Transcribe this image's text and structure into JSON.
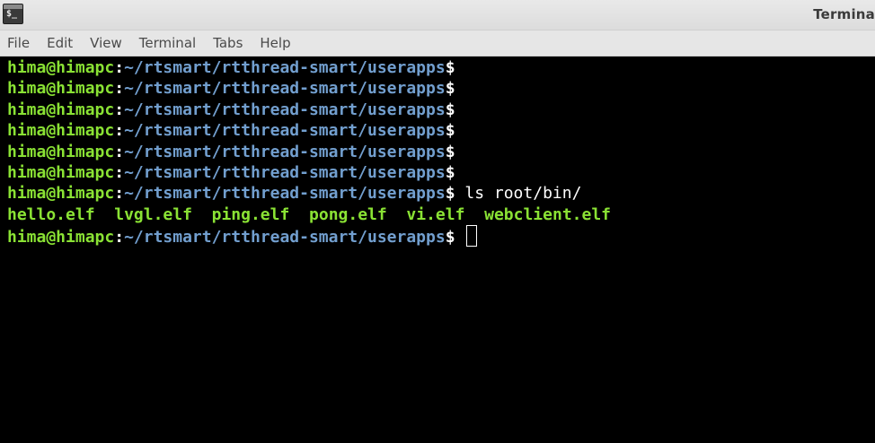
{
  "window": {
    "title": "Termina",
    "icon": "terminal-app-icon",
    "icon_glyph": "$_"
  },
  "menu": {
    "items": [
      "File",
      "Edit",
      "View",
      "Terminal",
      "Tabs",
      "Help"
    ]
  },
  "colors": {
    "background": "#000000",
    "userhost": "#8ae234",
    "path": "#729fcf",
    "text": "#ffffff",
    "executable": "#8ae234"
  },
  "terminal": {
    "prompt": {
      "userhost": "hima@himapc",
      "separator": ":",
      "path": "~/rtsmart/rtthread-smart/userapps",
      "sign": "$"
    },
    "command": "ls root/bin/",
    "ls_output": [
      "hello.elf",
      "lvgl.elf",
      "ping.elf",
      "pong.elf",
      "vi.elf",
      "webclient.elf"
    ]
  }
}
